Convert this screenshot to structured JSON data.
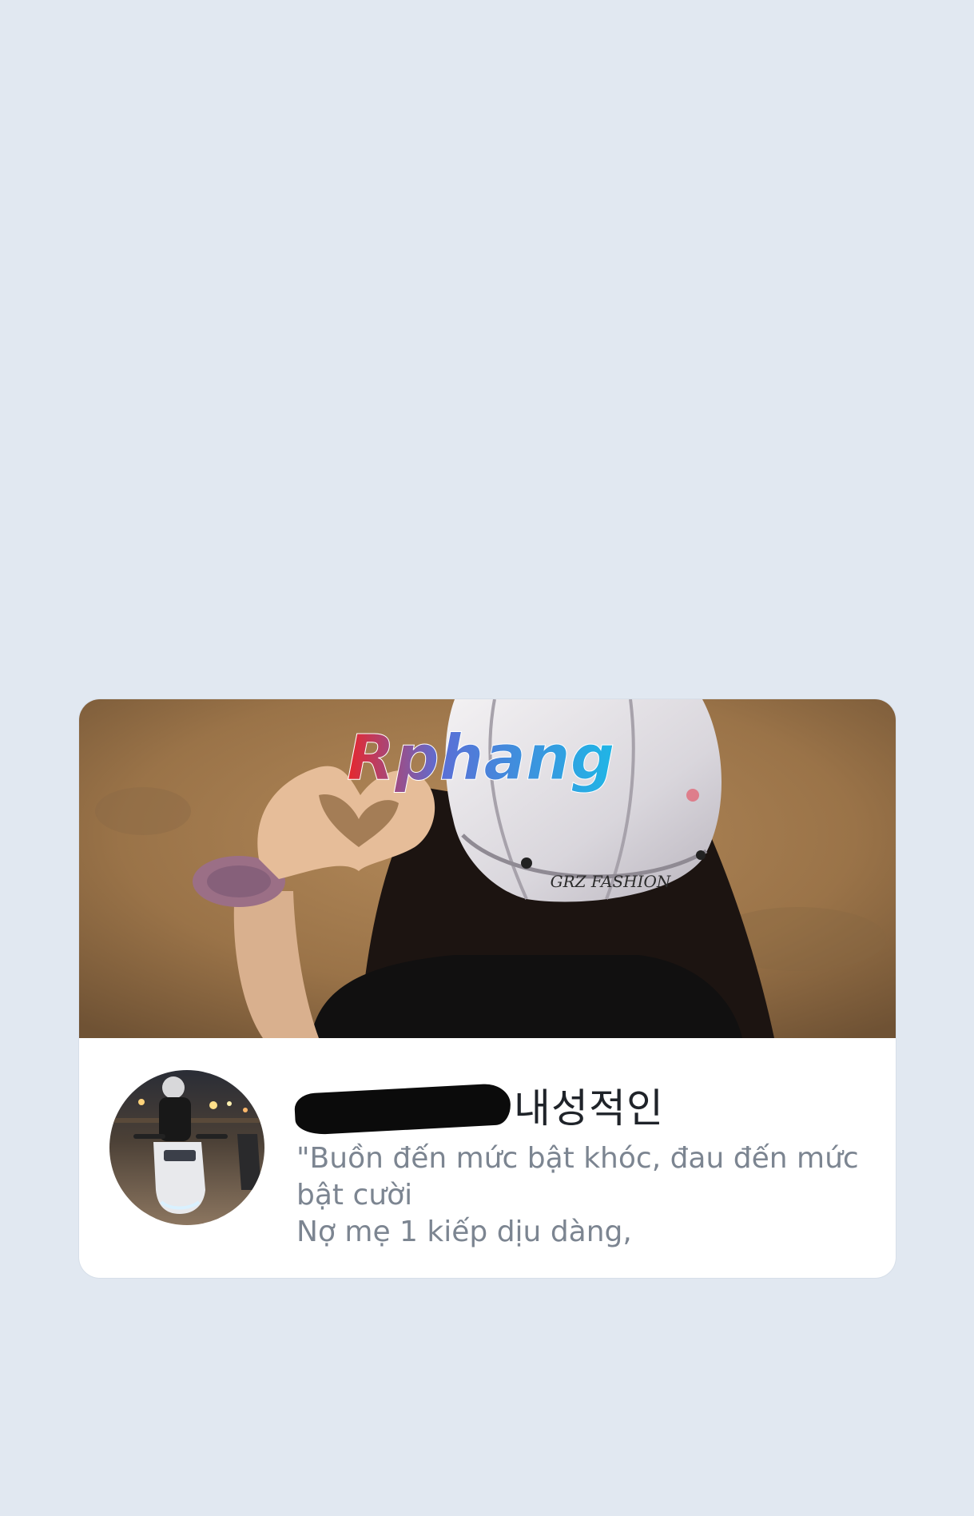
{
  "profile": {
    "cover_watermark": "Rphang",
    "helmet_text": "GRZ FASHION",
    "name_suffix": "내성적인",
    "bio_lines": [
      "\"Buồn đến mức bật khóc, đau đến mức",
      "bật cười",
      "Nợ mẹ 1 kiếp dịu dàng,"
    ]
  },
  "colors": {
    "background": "#e1e8f1",
    "card": "#ffffff",
    "name": "#1f2329",
    "bio": "#7c8591"
  }
}
